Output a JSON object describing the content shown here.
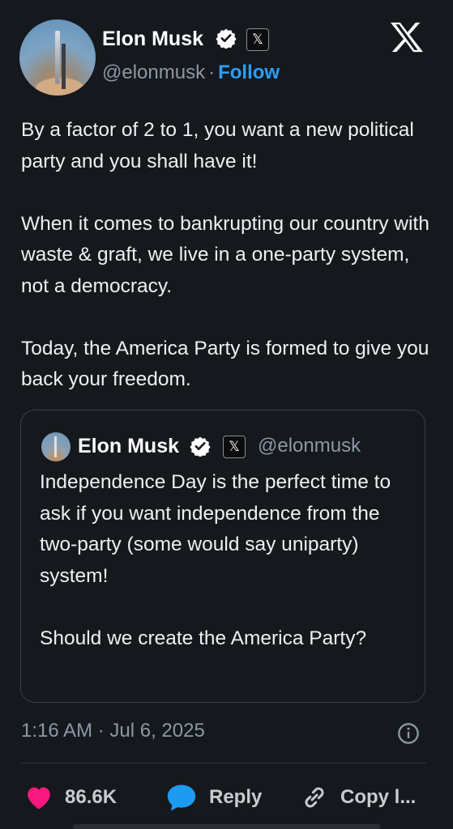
{
  "tweet": {
    "author_name": "Elon Musk",
    "author_handle": "@elonmusk",
    "separator": "·",
    "follow_label": "Follow",
    "x_badge": "𝕏",
    "paragraphs": [
      "By a factor of 2 to 1, you want a new political party and you shall have it!",
      "When it comes to bankrupting our country with waste & graft, we live in a one-party system, not a democracy.",
      "Today, the America Party is formed to give you back your freedom."
    ],
    "timestamp": "1:16 AM · Jul 6, 2025"
  },
  "quoted_tweet": {
    "author_name": "Elon Musk",
    "author_handle": "@elonmusk",
    "x_badge": "𝕏",
    "paragraphs": [
      "Independence Day is the perfect time to ask if you want independence from the two-party (some would say uniparty) system!",
      "Should we create the America Party?"
    ]
  },
  "actions": {
    "like_count": "86.6K",
    "reply_label": "Reply",
    "copy_label": "Copy l..."
  },
  "colors": {
    "background": "#15181d",
    "accent": "#2f9df4",
    "like": "#f91880"
  },
  "icons": [
    "verified-badge-icon",
    "x-logo-icon",
    "info-icon",
    "heart-icon",
    "reply-bubble-icon",
    "link-icon"
  ]
}
